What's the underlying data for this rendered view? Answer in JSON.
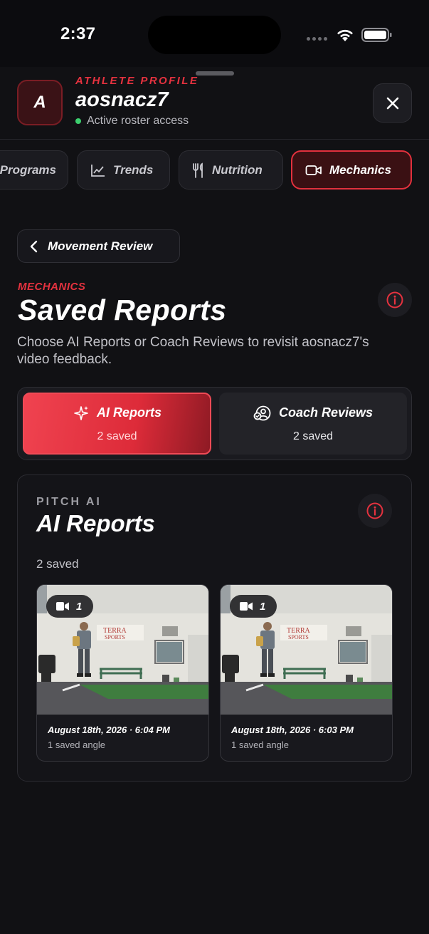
{
  "status_bar": {
    "time": "2:37"
  },
  "header": {
    "avatar_initial": "A",
    "eyebrow": "ATHLETE PROFILE",
    "username": "aosnacz7",
    "status": "Active roster access"
  },
  "tabs": [
    {
      "label": "Programs",
      "icon": "list-icon",
      "active": false
    },
    {
      "label": "Trends",
      "icon": "line-chart-icon",
      "active": false
    },
    {
      "label": "Nutrition",
      "icon": "fork-knife-icon",
      "active": false
    },
    {
      "label": "Mechanics",
      "icon": "video-camera-icon",
      "active": true
    }
  ],
  "back_button": {
    "label": "Movement Review"
  },
  "section": {
    "eyebrow": "MECHANICS",
    "title": "Saved Reports",
    "description": "Choose AI Reports or Coach Reviews to revisit aosnacz7's video feedback."
  },
  "toggle": {
    "ai": {
      "label": "AI Reports",
      "count": "2 saved",
      "icon": "sparkles-icon",
      "selected": true
    },
    "coach": {
      "label": "Coach Reviews",
      "count": "2 saved",
      "icon": "coach-icon",
      "selected": false
    }
  },
  "card": {
    "eyebrow": "PITCH AI",
    "title": "AI Reports",
    "count": "2 saved",
    "reports": [
      {
        "video_count": "1",
        "date": "August 18th, 2026 · 6:04 PM",
        "subtitle": "1 saved angle",
        "wall_sign_1": "TERRA",
        "wall_sign_2": "SPORTS"
      },
      {
        "video_count": "1",
        "date": "August 18th, 2026 · 6:03 PM",
        "subtitle": "1 saved angle",
        "wall_sign_1": "TERRA",
        "wall_sign_2": "SPORTS"
      }
    ]
  },
  "colors": {
    "accent": "#e5323f",
    "background": "#0c0c0f",
    "surface": "#1b1b20",
    "online": "#3ccf6e"
  }
}
